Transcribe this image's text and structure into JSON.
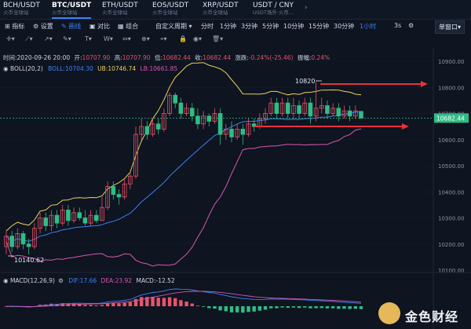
{
  "tabs": [
    {
      "name": "BCH/USDT",
      "sub": "火币全球站"
    },
    {
      "name": "BTC/USDT",
      "sub": "火币全球站",
      "active": true
    },
    {
      "name": "ETH/USDT",
      "sub": "火币全球站"
    },
    {
      "name": "EOS/USDT",
      "sub": "火币全球站"
    },
    {
      "name": "XRP/USDT",
      "sub": "火币全球站"
    },
    {
      "name": "USDT / CNY",
      "sub": "USDT场外·火币..."
    }
  ],
  "toolbar": {
    "indicators": "指标",
    "settings": "设置",
    "draw": "画线",
    "compare": "对比",
    "combine": "组合",
    "custom_period": "自定义周期",
    "periods": [
      "分时",
      "1分钟",
      "3分钟",
      "5分钟",
      "10分钟",
      "15分钟",
      "30分钟",
      "1小时"
    ],
    "active_period": "1小时",
    "refresh": "3s",
    "window_mode": "单窗口"
  },
  "ohlc": {
    "time_label": "时间:",
    "time": "2020-09-26 20:00",
    "open_label": "开:",
    "open": "10707.90",
    "high_label": "高:",
    "high": "10707.90",
    "low_label": "低:",
    "low": "10682.44",
    "close_label": "收:",
    "close": "10682.44",
    "change_label": "涨跌:",
    "change": "-0.24%(-25.46)",
    "amp_label": "振幅:",
    "amp": "0.24%"
  },
  "boll": {
    "title": "BOLL(20,2)",
    "boll_label": "BOLL:",
    "boll": "10704.30",
    "ub_label": "UB:",
    "ub": "10746.74",
    "lb_label": "LB:",
    "lb": "10661.85"
  },
  "macd": {
    "title": "MACD(12,26,9)",
    "dif_label": "DIF:",
    "dif": "17.66",
    "dea_label": "DEA:",
    "dea": "23.92",
    "macd_label": "MACD:",
    "macd": "-12.52"
  },
  "price_axis": [
    "10900.00",
    "10800.00",
    "10700.00",
    "10600.00",
    "10500.00",
    "10400.00",
    "10300.00",
    "10200.00",
    "10100.00"
  ],
  "current_price": "10682.44",
  "annotations": {
    "high_mark": "10820",
    "low_mark": "10140.62"
  },
  "watermark": "金色财经",
  "colors": {
    "up": "#e9546b",
    "down": "#2ebd85",
    "boll_mid": "#3b82f6",
    "boll_up": "#e8d45a",
    "boll_low": "#d658b0",
    "arrow": "#e8313a",
    "current": "#2ebd85"
  },
  "candles": [
    [
      10190,
      10230,
      10160,
      10250
    ],
    [
      10230,
      10190,
      10170,
      10250
    ],
    [
      10190,
      10240,
      10180,
      10260
    ],
    [
      10240,
      10200,
      10180,
      10250
    ],
    [
      10200,
      10190,
      10160,
      10220
    ],
    [
      10190,
      10260,
      10180,
      10280
    ],
    [
      10260,
      10300,
      10240,
      10320
    ],
    [
      10300,
      10270,
      10250,
      10320
    ],
    [
      10270,
      10310,
      10250,
      10330
    ],
    [
      10310,
      10280,
      10260,
      10330
    ],
    [
      10280,
      10330,
      10270,
      10350
    ],
    [
      10330,
      10290,
      10270,
      10350
    ],
    [
      10290,
      10320,
      10280,
      10340
    ],
    [
      10320,
      10300,
      10290,
      10340
    ],
    [
      10300,
      10280,
      10270,
      10330
    ],
    [
      10280,
      10310,
      10270,
      10330
    ],
    [
      10310,
      10290,
      10280,
      10330
    ],
    [
      10290,
      10340,
      10290,
      10380
    ],
    [
      10340,
      10420,
      10330,
      10440
    ],
    [
      10420,
      10390,
      10370,
      10440
    ],
    [
      10390,
      10380,
      10350,
      10410
    ],
    [
      10380,
      10430,
      10370,
      10450
    ],
    [
      10430,
      10460,
      10410,
      10480
    ],
    [
      10460,
      10620,
      10450,
      10650
    ],
    [
      10620,
      10650,
      10600,
      10680
    ],
    [
      10650,
      10620,
      10600,
      10670
    ],
    [
      10620,
      10660,
      10610,
      10680
    ],
    [
      10660,
      10640,
      10620,
      10680
    ],
    [
      10640,
      10700,
      10630,
      10720
    ],
    [
      10700,
      10770,
      10690,
      10780
    ],
    [
      10770,
      10740,
      10720,
      10780
    ],
    [
      10740,
      10700,
      10680,
      10760
    ],
    [
      10700,
      10720,
      10690,
      10740
    ],
    [
      10720,
      10690,
      10670,
      10740
    ],
    [
      10690,
      10660,
      10640,
      10720
    ],
    [
      10660,
      10690,
      10640,
      10710
    ],
    [
      10690,
      10670,
      10650,
      10700
    ],
    [
      10670,
      10700,
      10660,
      10720
    ],
    [
      10700,
      10620,
      10580,
      10720
    ],
    [
      10620,
      10640,
      10600,
      10660
    ],
    [
      10640,
      10610,
      10590,
      10670
    ],
    [
      10610,
      10640,
      10600,
      10660
    ],
    [
      10640,
      10620,
      10580,
      10660
    ],
    [
      10620,
      10660,
      10610,
      10680
    ],
    [
      10660,
      10650,
      10630,
      10680
    ],
    [
      10650,
      10680,
      10640,
      10700
    ],
    [
      10680,
      10700,
      10660,
      10720
    ],
    [
      10700,
      10740,
      10690,
      10760
    ],
    [
      10740,
      10700,
      10680,
      10760
    ],
    [
      10700,
      10740,
      10690,
      10760
    ],
    [
      10740,
      10700,
      10680,
      10760
    ],
    [
      10700,
      10730,
      10680,
      10760
    ],
    [
      10730,
      10700,
      10680,
      10750
    ],
    [
      10700,
      10740,
      10690,
      10760
    ],
    [
      10740,
      10690,
      10660,
      10760
    ],
    [
      10690,
      10720,
      10670,
      10820
    ],
    [
      10720,
      10730,
      10700,
      10760
    ],
    [
      10730,
      10700,
      10680,
      10750
    ],
    [
      10700,
      10720,
      10690,
      10740
    ],
    [
      10720,
      10690,
      10670,
      10740
    ],
    [
      10690,
      10710,
      10680,
      10730
    ],
    [
      10710,
      10690,
      10670,
      10730
    ],
    [
      10690,
      10710,
      10680,
      10730
    ],
    [
      10708,
      10682,
      10682,
      10708
    ]
  ]
}
